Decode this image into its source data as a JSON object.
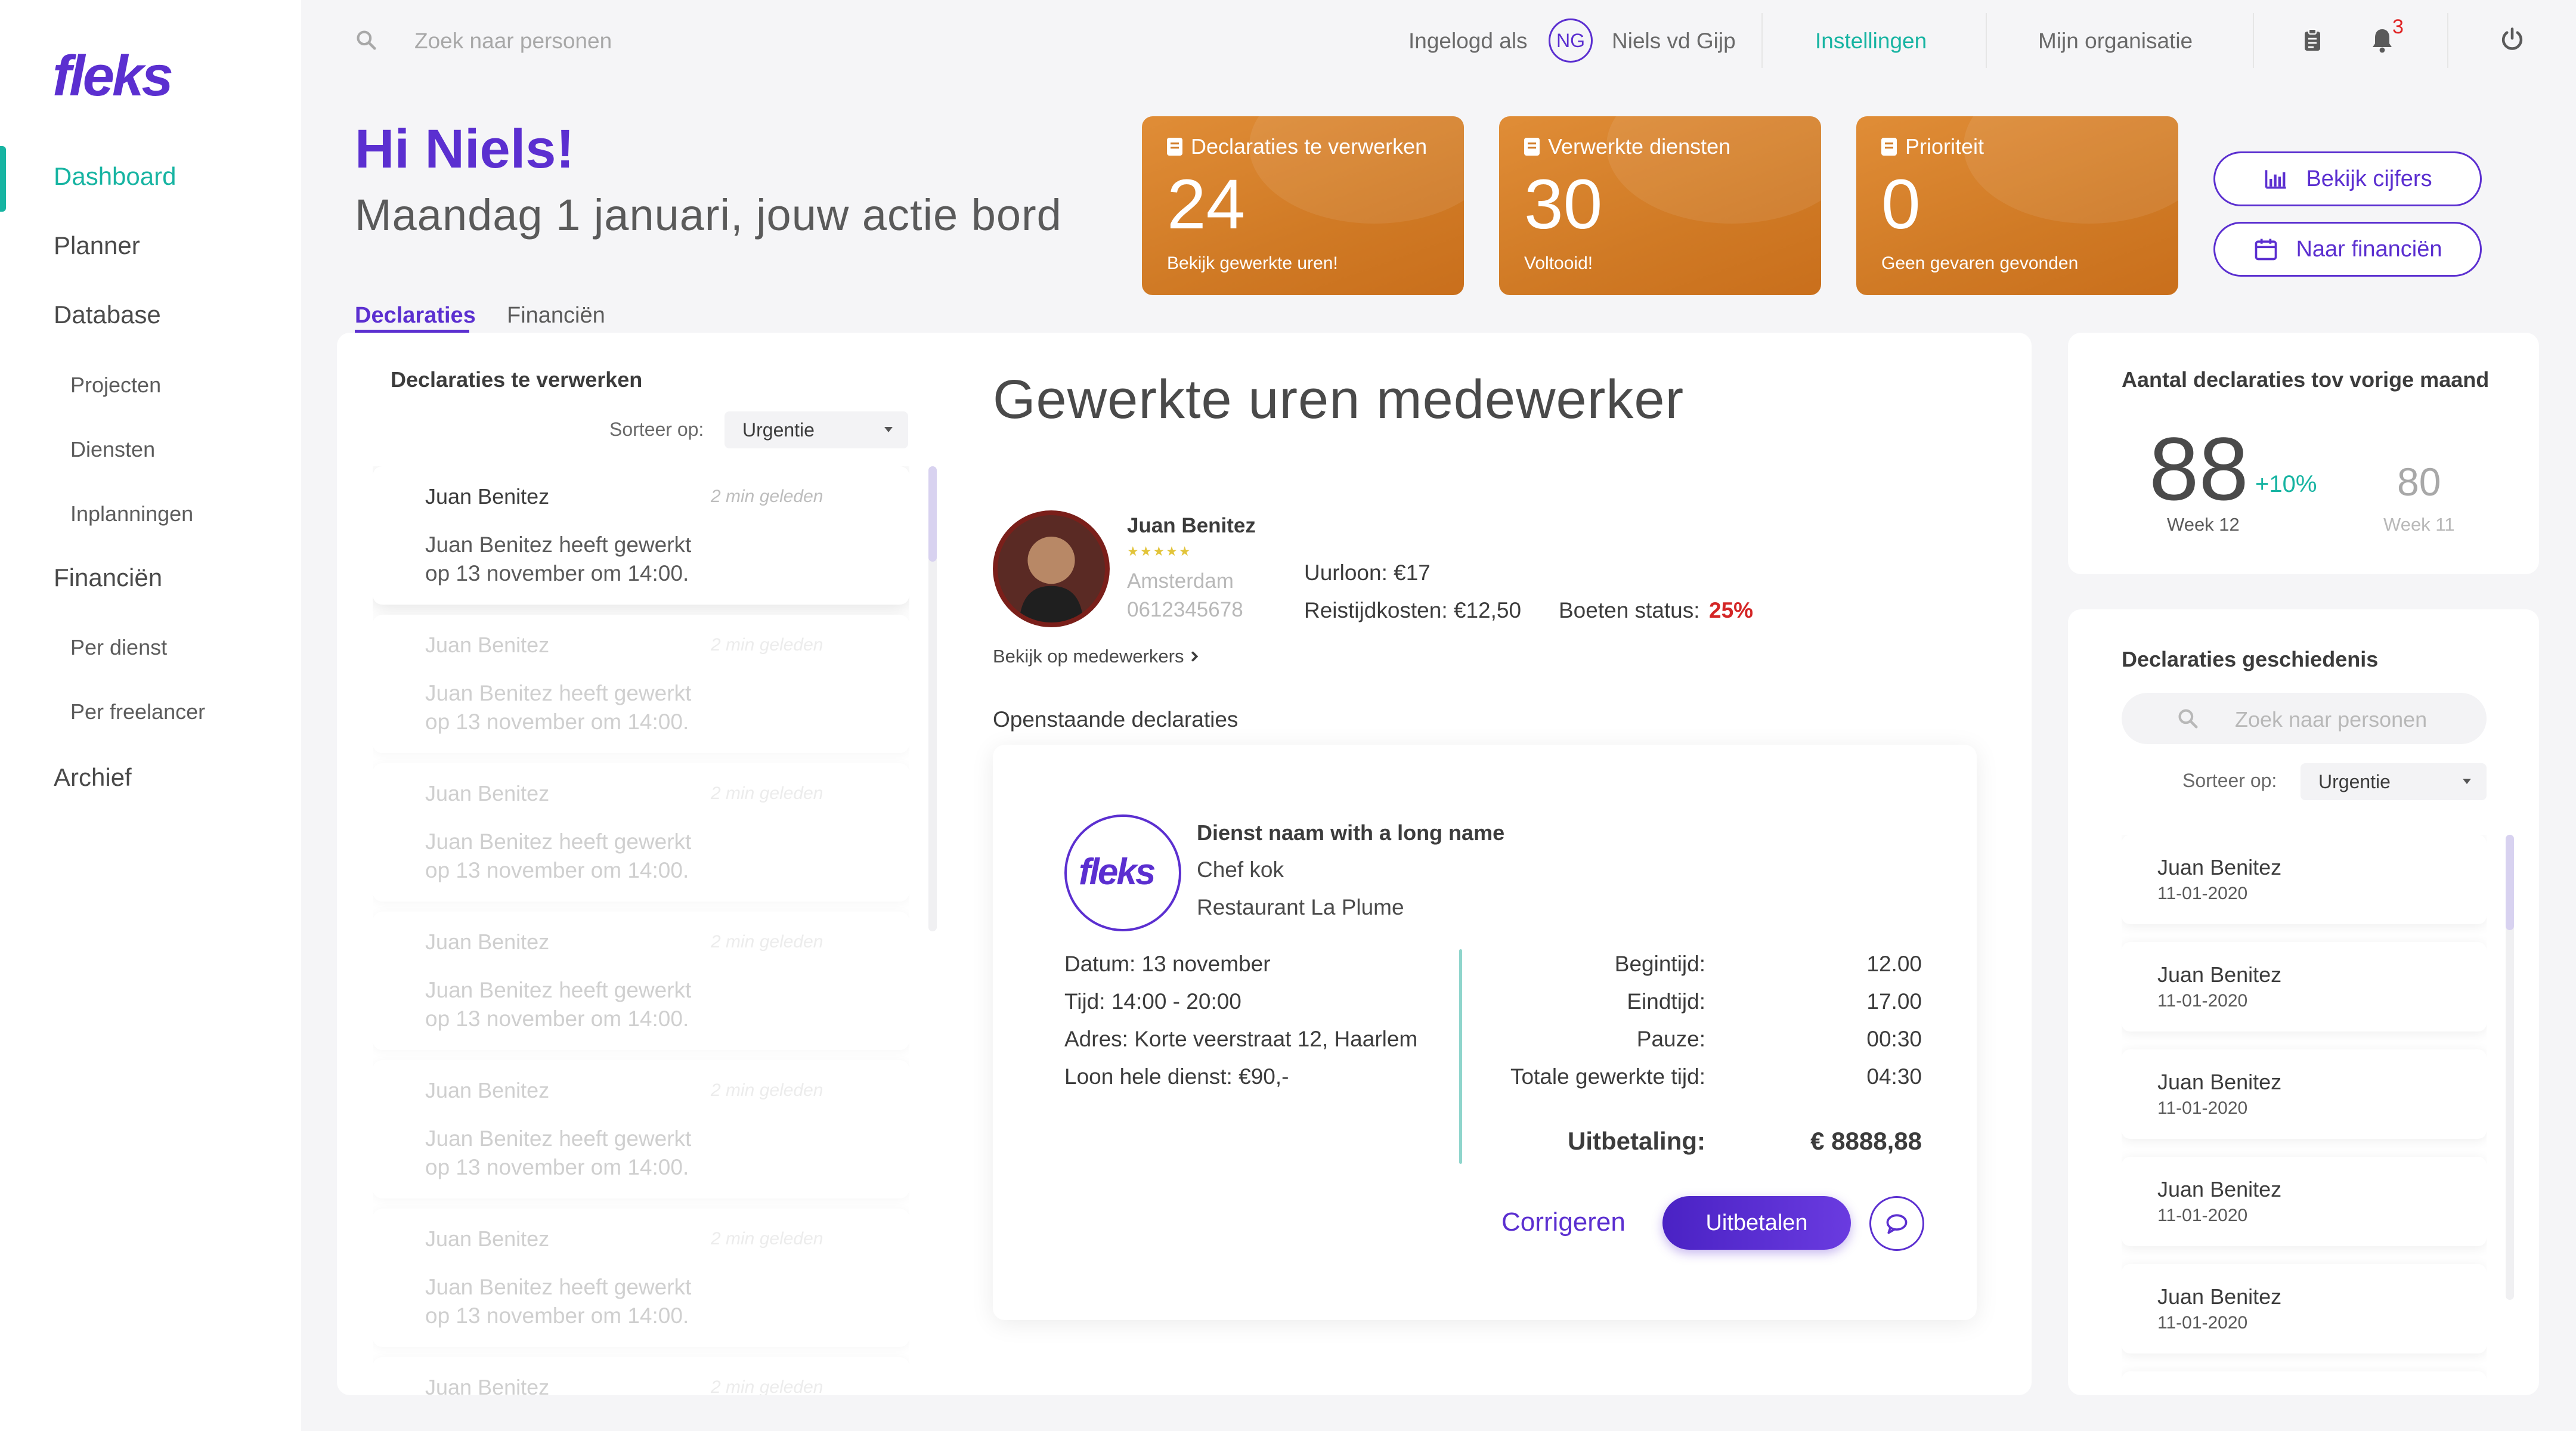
{
  "brand": {
    "name": "fleks",
    "color": "#5b2fd0",
    "accent": "#17b4a2"
  },
  "sidebar": {
    "items": [
      {
        "label": "Dashboard"
      },
      {
        "label": "Planner"
      },
      {
        "label": "Database"
      },
      {
        "label": "Projecten"
      },
      {
        "label": "Diensten"
      },
      {
        "label": "Inplanningen"
      },
      {
        "label": "Financiën"
      },
      {
        "label": "Per dienst"
      },
      {
        "label": "Per freelancer"
      },
      {
        "label": "Archief"
      }
    ]
  },
  "topbar": {
    "search_placeholder": "Zoek naar personen",
    "login_label": "Ingelogd als",
    "user_initials": "NG",
    "user_name": "Niels vd Gijp",
    "settings": "Instellingen",
    "organisation": "Mijn organisatie",
    "notification_count": "3"
  },
  "header": {
    "greeting": "Hi Niels!",
    "subtitle": "Maandag 1 januari, jouw actie bord"
  },
  "stats": [
    {
      "title": "Declaraties te verwerken",
      "value": "24",
      "sub": "Bekijk gewerkte uren!"
    },
    {
      "title": "Verwerkte diensten",
      "value": "30",
      "sub": "Voltooid!"
    },
    {
      "title": "Prioriteit",
      "value": "0",
      "sub": "Geen gevaren gevonden"
    }
  ],
  "actions": {
    "view_figures": "Bekijk cijfers",
    "to_finance": "Naar financiën"
  },
  "tabs": [
    {
      "label": "Declaraties"
    },
    {
      "label": "Financiën"
    }
  ],
  "list": {
    "title": "Declaraties te verwerken",
    "sort_label": "Sorteer op:",
    "sort_value": "Urgentie",
    "items": [
      {
        "name": "Juan Benitez",
        "time": "2 min geleden",
        "line1": "Juan Benitez heeft gewerkt",
        "line2": "op 13 november om 14:00."
      },
      {
        "name": "Juan Benitez",
        "time": "2 min geleden",
        "line1": "Juan Benitez heeft gewerkt",
        "line2": "op 13 november om 14:00."
      },
      {
        "name": "Juan Benitez",
        "time": "2 min geleden",
        "line1": "Juan Benitez heeft gewerkt",
        "line2": "op 13 november om 14:00."
      },
      {
        "name": "Juan Benitez",
        "time": "2 min geleden",
        "line1": "Juan Benitez heeft gewerkt",
        "line2": "op 13 november om 14:00."
      },
      {
        "name": "Juan Benitez",
        "time": "2 min geleden",
        "line1": "Juan Benitez heeft gewerkt",
        "line2": "op 13 november om 14:00."
      },
      {
        "name": "Juan Benitez",
        "time": "2 min geleden",
        "line1": "Juan Benitez heeft gewerkt",
        "line2": "op 13 november om 14:00."
      },
      {
        "name": "Juan Benitez",
        "time": "2 min geleden",
        "line1": "",
        "line2": ""
      }
    ]
  },
  "detail": {
    "title": "Gewerkte uren medewerker",
    "employee": {
      "name": "Juan Benitez",
      "stars": "★★★★★",
      "city": "Amsterdam",
      "phone": "0612345678",
      "wage": "Uurloon: €17",
      "travel": "Reistijdkosten: €12,50",
      "fines_label": "Boeten status:",
      "fines_value": "25%",
      "link": "Bekijk op medewerkers"
    },
    "open_title": "Openstaande declaraties",
    "service": {
      "name": "Dienst naam with a long name",
      "role": "Chef kok",
      "venue": "Restaurant La Plume"
    },
    "info": [
      {
        "label": "Datum:",
        "value": "13 november"
      },
      {
        "label": "Tijd:",
        "value": "14:00 - 20:00"
      },
      {
        "label": "Adres:",
        "value": "Korte veerstraat 12, Haarlem"
      },
      {
        "label": "Loon hele dienst:",
        "value": "€90,-"
      }
    ],
    "times": [
      {
        "label": "Begintijd:",
        "value": "12.00"
      },
      {
        "label": "Eindtijd:",
        "value": "17.00"
      },
      {
        "label": "Pauze:",
        "value": "00:30"
      },
      {
        "label": "Totale gewerkte tijd:",
        "value": "04:30"
      }
    ],
    "payout_label": "Uitbetaling:",
    "payout_value": "€ 8888,88",
    "correct": "Corrigeren",
    "pay": "Uitbetalen"
  },
  "compare": {
    "title": "Aantal declaraties tov vorige maand",
    "current": "88",
    "change": "+10%",
    "previous": "80",
    "current_week": "Week 12",
    "previous_week": "Week 11"
  },
  "history": {
    "title": "Declaraties geschiedenis",
    "search_placeholder": "Zoek naar personen",
    "sort_label": "Sorteer op:",
    "sort_value": "Urgentie",
    "items": [
      {
        "name": "Juan Benitez",
        "date": "11-01-2020"
      },
      {
        "name": "Juan Benitez",
        "date": "11-01-2020"
      },
      {
        "name": "Juan Benitez",
        "date": "11-01-2020"
      },
      {
        "name": "Juan Benitez",
        "date": "11-01-2020"
      },
      {
        "name": "Juan Benitez",
        "date": "11-01-2020"
      },
      {
        "name": "",
        "date": ""
      }
    ]
  }
}
